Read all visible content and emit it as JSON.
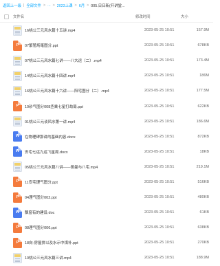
{
  "breadcrumb": {
    "back": "返回上一级",
    "sep": "|",
    "all": "全部文件",
    "gt": ">",
    "ellipsis": "...",
    "level1": "2023上课",
    "level2": "6月",
    "current": "005.日日新(开讲堂..."
  },
  "table_header": {
    "name": "文件名",
    "date": "修改时间",
    "size": "大小"
  },
  "rows": [
    {
      "type": "mp4",
      "name": "16桃公三元风水篇十五讲.mp4",
      "date": "2023-05-25 10:51",
      "size": "157.9M"
    },
    {
      "type": "ppt",
      "name": "07繁殖场笔图分.ppt",
      "date": "2023-05-25 10:51",
      "size": "678KB"
    },
    {
      "type": "mp4",
      "name": "07桃公三元风水篇七讲——八大运（二）.mp4",
      "date": "2023-05-25 10:51",
      "size": "173.4M"
    },
    {
      "type": "mp4",
      "name": "14桃公三元风水篇十四讲.mp4",
      "date": "2023-05-25 10:51",
      "size": "186M"
    },
    {
      "type": "mp4",
      "name": "16桃公三元风水篇十六讲——阳宅图分（二）.mp4",
      "date": "2023-05-25 10:51",
      "size": "177.5M"
    },
    {
      "type": "ppt",
      "name": "10砂气图分008丞乘七星打劫局.ppt",
      "date": "2023-05-25 10:51",
      "size": "622KB"
    },
    {
      "type": "mp4",
      "name": "01桃公三元谈风水第一讲.mp4",
      "date": "2023-05-25 10:51",
      "size": "186.6M"
    },
    {
      "type": "doc",
      "name": "在物理碑那讲的基础内容.docx",
      "date": "2023-05-25 10:51",
      "size": "872KB"
    },
    {
      "type": "doc",
      "name": "安宅七运九运飞星局.docx",
      "date": "2023-05-25 10:51",
      "size": "18KB"
    },
    {
      "type": "mp4",
      "name": "05桃公三元风水篇八讲——佩曼与八宅.mp4",
      "date": "2023-05-25 10:51",
      "size": "219.1M"
    },
    {
      "type": "ppt",
      "name": "11安宅理气图分.ppt",
      "date": "2023-05-25 10:51",
      "size": "516KB"
    },
    {
      "type": "ppt",
      "name": "04理气图分002.ppt",
      "date": "2023-05-25 10:51",
      "size": "480KB"
    },
    {
      "type": "doc",
      "name": "飘窗有的建设.doc",
      "date": "2023-05-25 10:51",
      "size": "61KB"
    },
    {
      "type": "ppt",
      "name": "08理气图分006.ppt",
      "date": "2023-05-25 10:51",
      "size": "638KB"
    },
    {
      "type": "ppt",
      "name": "18向-房屋拼以及水示中煤补.ppt",
      "date": "2023-05-25 10:51",
      "size": "270KB"
    },
    {
      "type": "mp4",
      "name": "10桃公三元风水篇三讲.mp4",
      "date": "2023-05-25 10:51",
      "size": "188.9M"
    }
  ]
}
